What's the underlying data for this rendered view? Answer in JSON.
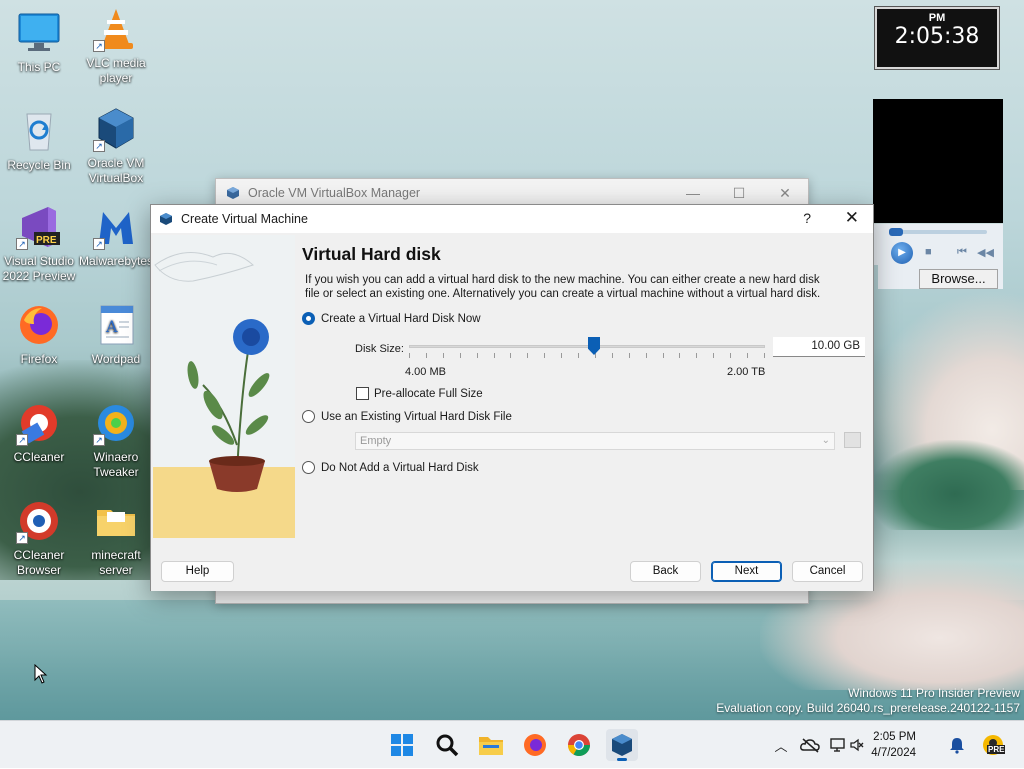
{
  "desktop": {
    "icons": [
      {
        "label": "This PC"
      },
      {
        "label": "VLC media player"
      },
      {
        "label": "Recycle Bin"
      },
      {
        "label": "Oracle VM VirtualBox"
      },
      {
        "label": "Visual Studio 2022 Preview"
      },
      {
        "label": "Malwarebytes"
      },
      {
        "label": "Firefox"
      },
      {
        "label": "Wordpad"
      },
      {
        "label": "CCleaner"
      },
      {
        "label": "Winaero Tweaker"
      },
      {
        "label": "CCleaner Browser"
      },
      {
        "label": "minecraft server"
      }
    ],
    "pre_badge": "PRE"
  },
  "clock_widget": {
    "ampm": "PM",
    "time": "2:05:38"
  },
  "media_widget": {
    "browse_label": "Browse..."
  },
  "vbox_manager": {
    "title": "Oracle VM VirtualBox Manager"
  },
  "dialog": {
    "title": "Create Virtual Machine",
    "help_glyph": "?",
    "close_glyph": "✕",
    "heading": "Virtual Hard disk",
    "description": "If you wish you can add a virtual hard disk to the new machine. You can either create a new hard disk file or select an existing one. Alternatively you can create a virtual machine without a virtual hard disk.",
    "option_create": "Create a Virtual Hard Disk Now",
    "disk_size_label": "Disk Size:",
    "disk_size_value": "10.00 GB",
    "disk_size_fraction": 0.52,
    "min_label": "4.00 MB",
    "max_label": "2.00 TB",
    "preallocate_label": "Pre-allocate Full Size",
    "option_existing": "Use an Existing Virtual Hard Disk File",
    "existing_placeholder": "Empty",
    "option_none": "Do Not Add a Virtual Hard Disk",
    "buttons": {
      "help": "Help",
      "back": "Back",
      "next": "Next",
      "cancel": "Cancel"
    }
  },
  "watermark": {
    "line1": "Windows 11 Pro Insider Preview",
    "line2": "Evaluation copy. Build 26040.rs_prerelease.240122-1157"
  },
  "taskbar": {
    "time": "2:05 PM",
    "date": "4/7/2024",
    "tray_badge": "PRE"
  },
  "colors": {
    "accent": "#0b5fb5",
    "taskbar": "#eef1f4"
  }
}
